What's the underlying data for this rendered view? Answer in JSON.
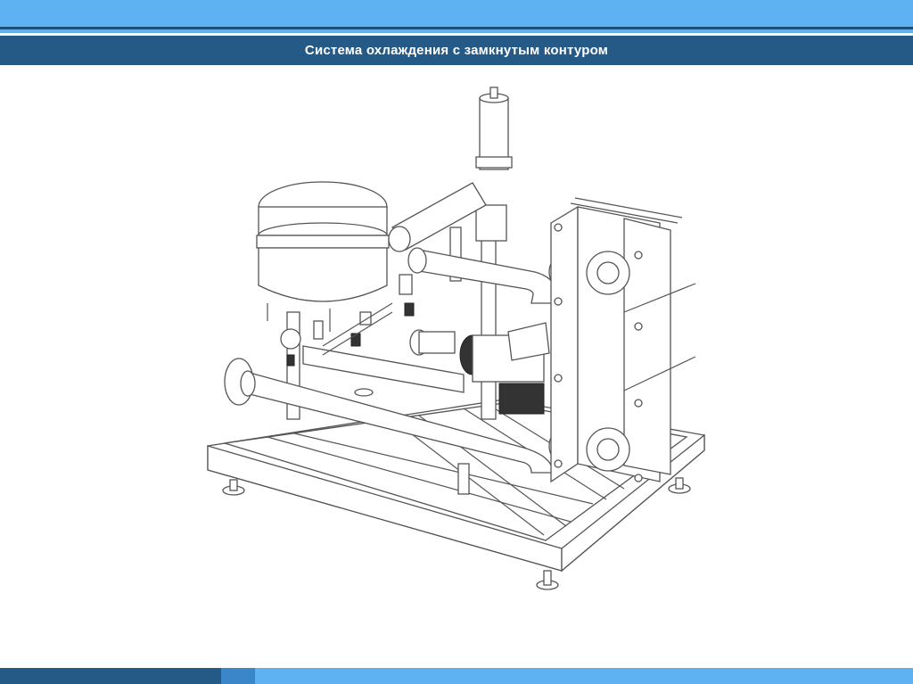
{
  "slide": {
    "title": "Система охлаждения с замкнутым контуром"
  },
  "colors": {
    "header_light": "#5fb2f2",
    "header_dark": "#255a87",
    "footer_mid": "#3b86c8"
  }
}
